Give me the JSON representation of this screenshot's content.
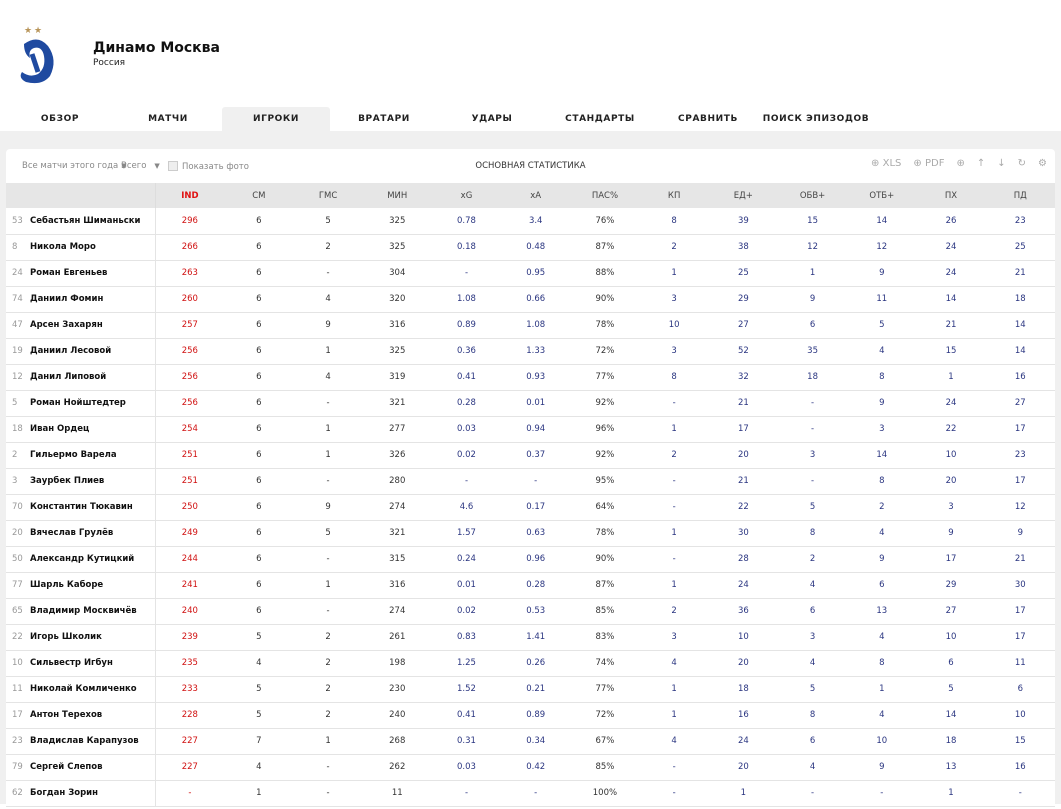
{
  "team": {
    "name": "Динамо Москва",
    "country": "Россия"
  },
  "tabs": [
    "ОБЗОР",
    "МАТЧИ",
    "ИГРОКИ",
    "ВРАТАРИ",
    "УДАРЫ",
    "СТАНДАРТЫ",
    "СРАВНИТЬ",
    "ПОИСК ЭПИЗОДОВ"
  ],
  "active_tab": 2,
  "toolbar": {
    "period": "Все матчи этого года",
    "mode": "Всего",
    "show_photo": "Показать фото",
    "title": "ОСНОВНАЯ СТАТИСТИКА",
    "xls": "XLS",
    "pdf": "PDF"
  },
  "colors": {
    "ind": "#d01010",
    "blue": "#2a3580"
  },
  "columns": [
    "IND",
    "СМ",
    "ГМС",
    "МИН",
    "xG",
    "xA",
    "ПАС%",
    "КП",
    "ЕД+",
    "ОБВ+",
    "ОТБ+",
    "ПХ",
    "ПД"
  ],
  "rows": [
    [
      "53",
      "Себастьян Шиманьски",
      "296",
      "6",
      "5",
      "325",
      "0.78",
      "3.4",
      "76%",
      "8",
      "39",
      "15",
      "14",
      "26",
      "23"
    ],
    [
      "8",
      "Никола Моро",
      "266",
      "6",
      "2",
      "325",
      "0.18",
      "0.48",
      "87%",
      "2",
      "38",
      "12",
      "12",
      "24",
      "25"
    ],
    [
      "24",
      "Роман Евгеньев",
      "263",
      "6",
      "-",
      "304",
      "-",
      "0.95",
      "88%",
      "1",
      "25",
      "1",
      "9",
      "24",
      "21"
    ],
    [
      "74",
      "Даниил Фомин",
      "260",
      "6",
      "4",
      "320",
      "1.08",
      "0.66",
      "90%",
      "3",
      "29",
      "9",
      "11",
      "14",
      "18"
    ],
    [
      "47",
      "Арсен Захарян",
      "257",
      "6",
      "9",
      "316",
      "0.89",
      "1.08",
      "78%",
      "10",
      "27",
      "6",
      "5",
      "21",
      "14"
    ],
    [
      "19",
      "Даниил Лесовой",
      "256",
      "6",
      "1",
      "325",
      "0.36",
      "1.33",
      "72%",
      "3",
      "52",
      "35",
      "4",
      "15",
      "14"
    ],
    [
      "12",
      "Данил Липовой",
      "256",
      "6",
      "4",
      "319",
      "0.41",
      "0.93",
      "77%",
      "8",
      "32",
      "18",
      "8",
      "1",
      "16"
    ],
    [
      "5",
      "Роман Нойштедтер",
      "256",
      "6",
      "-",
      "321",
      "0.28",
      "0.01",
      "92%",
      "-",
      "21",
      "-",
      "9",
      "24",
      "27"
    ],
    [
      "18",
      "Иван Ордец",
      "254",
      "6",
      "1",
      "277",
      "0.03",
      "0.94",
      "96%",
      "1",
      "17",
      "-",
      "3",
      "22",
      "17"
    ],
    [
      "2",
      "Гильермо Варела",
      "251",
      "6",
      "1",
      "326",
      "0.02",
      "0.37",
      "92%",
      "2",
      "20",
      "3",
      "14",
      "10",
      "23"
    ],
    [
      "3",
      "Заурбек Плиев",
      "251",
      "6",
      "-",
      "280",
      "-",
      "-",
      "95%",
      "-",
      "21",
      "-",
      "8",
      "20",
      "17"
    ],
    [
      "70",
      "Константин Тюкавин",
      "250",
      "6",
      "9",
      "274",
      "4.6",
      "0.17",
      "64%",
      "-",
      "22",
      "5",
      "2",
      "3",
      "12"
    ],
    [
      "20",
      "Вячеслав Грулёв",
      "249",
      "6",
      "5",
      "321",
      "1.57",
      "0.63",
      "78%",
      "1",
      "30",
      "8",
      "4",
      "9",
      "9"
    ],
    [
      "50",
      "Александр Кутицкий",
      "244",
      "6",
      "-",
      "315",
      "0.24",
      "0.96",
      "90%",
      "-",
      "28",
      "2",
      "9",
      "17",
      "21"
    ],
    [
      "77",
      "Шарль Каборе",
      "241",
      "6",
      "1",
      "316",
      "0.01",
      "0.28",
      "87%",
      "1",
      "24",
      "4",
      "6",
      "29",
      "30"
    ],
    [
      "65",
      "Владимир Москвичёв",
      "240",
      "6",
      "-",
      "274",
      "0.02",
      "0.53",
      "85%",
      "2",
      "36",
      "6",
      "13",
      "27",
      "17"
    ],
    [
      "22",
      "Игорь Школик",
      "239",
      "5",
      "2",
      "261",
      "0.83",
      "1.41",
      "83%",
      "3",
      "10",
      "3",
      "4",
      "10",
      "17"
    ],
    [
      "10",
      "Сильвестр Игбун",
      "235",
      "4",
      "2",
      "198",
      "1.25",
      "0.26",
      "74%",
      "4",
      "20",
      "4",
      "8",
      "6",
      "11"
    ],
    [
      "11",
      "Николай Комличенко",
      "233",
      "5",
      "2",
      "230",
      "1.52",
      "0.21",
      "77%",
      "1",
      "18",
      "5",
      "1",
      "5",
      "6"
    ],
    [
      "17",
      "Антон Терехов",
      "228",
      "5",
      "2",
      "240",
      "0.41",
      "0.89",
      "72%",
      "1",
      "16",
      "8",
      "4",
      "14",
      "10"
    ],
    [
      "23",
      "Владислав Карапузов",
      "227",
      "7",
      "1",
      "268",
      "0.31",
      "0.34",
      "67%",
      "4",
      "24",
      "6",
      "10",
      "18",
      "15"
    ],
    [
      "79",
      "Сергей Слепов",
      "227",
      "4",
      "-",
      "262",
      "0.03",
      "0.42",
      "85%",
      "-",
      "20",
      "4",
      "9",
      "13",
      "16"
    ],
    [
      "62",
      "Богдан Зорин",
      "-",
      "1",
      "-",
      "11",
      "-",
      "-",
      "100%",
      "-",
      "1",
      "-",
      "-",
      "1",
      "-"
    ]
  ]
}
